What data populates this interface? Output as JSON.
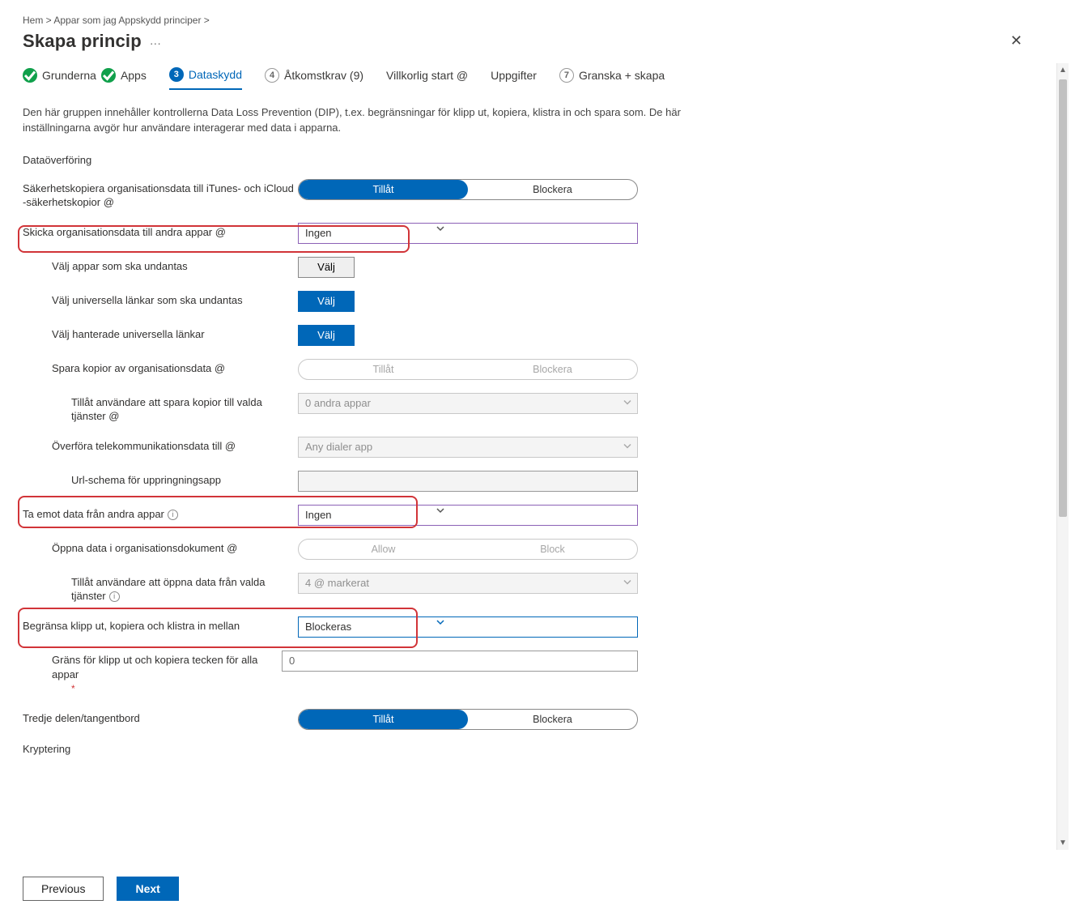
{
  "breadcrumb": "Hem &gt;   Appar som jag Appskydd principer &gt;",
  "page_title": "Skapa princip",
  "close_label": "✕",
  "tabs": {
    "t1": "Grunderna",
    "t2": "Apps",
    "t3": "Dataskydd",
    "t4": "Åtkomstkrav (9)",
    "t5": "Villkorlig start @",
    "t6": "Uppgifter",
    "t7": "Granska + skapa",
    "n3": "3",
    "n4": "4",
    "n7": "7"
  },
  "intro": "Den här gruppen innehåller kontrollerna Data Loss Prevention (DIP), t.ex. begränsningar för klipp ut, kopiera, klistra in och spara som. De här inställningarna avgör hur användare interagerar med data i apparna.",
  "sections": {
    "data_transfer": "Dataöverföring",
    "keyboard": "Tredje delen/tangentbord",
    "encryption": "Kryptering"
  },
  "labels": {
    "backup": "Säkerhetskopiera organisationsdata till iTunes- och iCloud -säkerhetskopior @",
    "send_org": "Skicka organisationsdata till andra appar @",
    "exclude_apps": "Välj appar som ska undantas",
    "exclude_links": "Välj universella länkar som ska undantas",
    "managed_links": "Välj hanterade universella länkar",
    "save_copies": "Spara kopior av organisationsdata @",
    "allow_save": "Tillåt användare att spara kopior till valda tjänster @",
    "telecom": "Överföra telekommunikationsdata till @",
    "url_scheme": "Url-schema för uppringningsapp",
    "receive": "Ta emot data från andra appar",
    "open_org": "Öppna data i organisationsdokument @",
    "allow_open": "Tillåt användare att öppna data från valda tjänster",
    "restrict_clip": "Begränsa klipp ut, kopiera och klistra in mellan",
    "clip_limit": "Gräns för klipp ut och kopiera tecken för alla appar"
  },
  "options": {
    "allow": "Tillåt",
    "block": "Blockera",
    "allow_en": "Allow",
    "block_en": "Block"
  },
  "values": {
    "send_org": "Ingen",
    "save_sel": "0 andra appar",
    "telecom": "Any dialer app",
    "receive": "Ingen",
    "open_sel": "4 @ markerat",
    "clip": "Blockeras",
    "clip_limit": "0"
  },
  "buttons": {
    "select": "Välj",
    "previous": "Previous",
    "next": "Next"
  }
}
